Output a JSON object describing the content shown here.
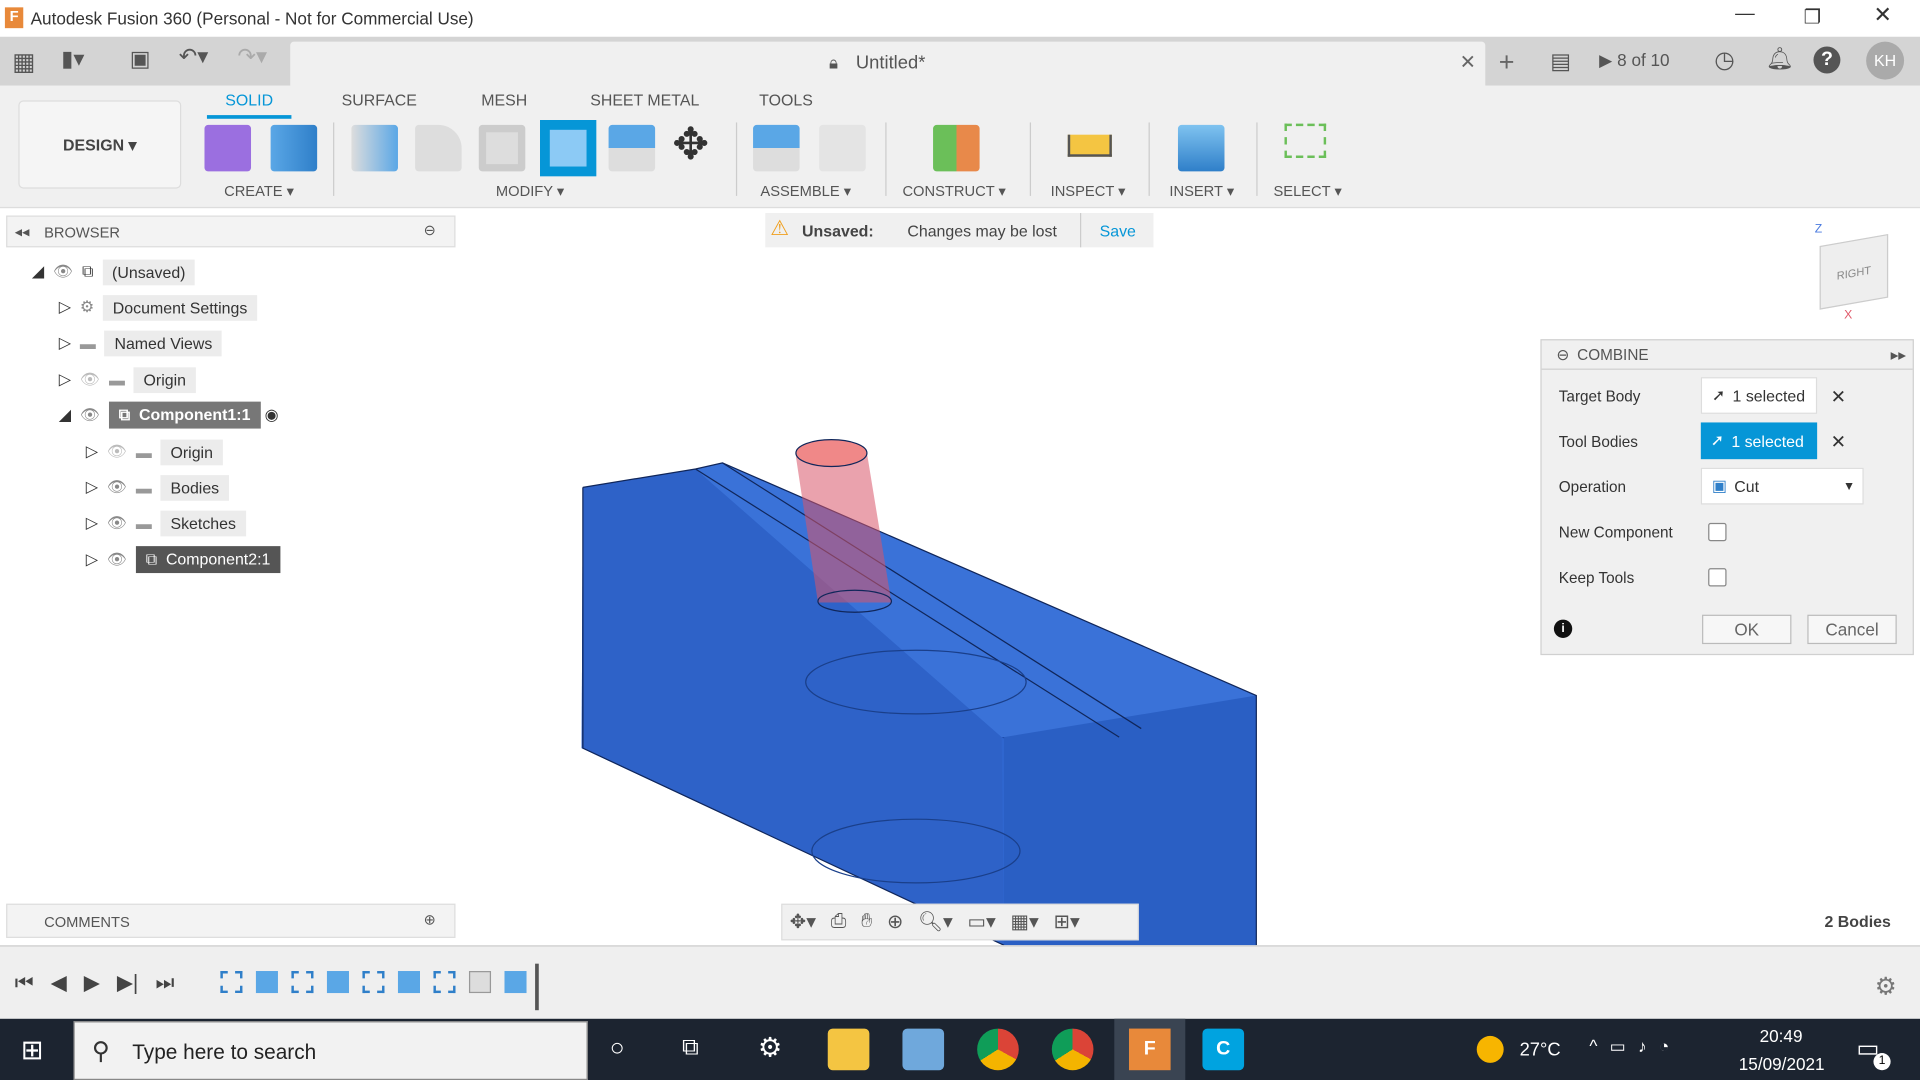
{
  "window": {
    "title": "Autodesk Fusion 360 (Personal - Not for Commercial Use)",
    "doc_tab": "Untitled*",
    "job_status": "8 of 10",
    "user_initials": "KH"
  },
  "ribbon": {
    "workspace": "DESIGN ▾",
    "tabs": [
      "SOLID",
      "SURFACE",
      "MESH",
      "SHEET METAL",
      "TOOLS"
    ],
    "groups": [
      "CREATE ▾",
      "MODIFY ▾",
      "ASSEMBLE ▾",
      "CONSTRUCT ▾",
      "INSPECT ▾",
      "INSERT ▾",
      "SELECT ▾"
    ]
  },
  "banner": {
    "title": "Unsaved:",
    "message": "Changes may be lost",
    "save": "Save"
  },
  "browser": {
    "title": "BROWSER",
    "items": [
      "(Unsaved)",
      "Document Settings",
      "Named Views",
      "Origin",
      "Component1:1",
      "Origin",
      "Bodies",
      "Sketches",
      "Component2:1"
    ]
  },
  "comments": {
    "title": "COMMENTS"
  },
  "viewcube": {
    "face": "RIGHT",
    "axis_z": "Z",
    "axis_x": "X"
  },
  "combine": {
    "title": "COMBINE",
    "target_label": "Target Body",
    "target_value": "1 selected",
    "tool_label": "Tool Bodies",
    "tool_value": "1 selected",
    "operation_label": "Operation",
    "operation_value": "Cut",
    "new_component_label": "New Component",
    "new_component": false,
    "keep_tools_label": "Keep Tools",
    "keep_tools": false,
    "ok": "OK",
    "cancel": "Cancel"
  },
  "status": {
    "bodies": "2 Bodies"
  },
  "taskbar": {
    "search_placeholder": "Type here to search",
    "weather": "27°C",
    "time": "20:49",
    "date": "15/09/2021",
    "notifications": "1"
  },
  "colors": {
    "accent": "#0696d7",
    "body": "#2a5fc4",
    "tool": "#e05a6a"
  }
}
